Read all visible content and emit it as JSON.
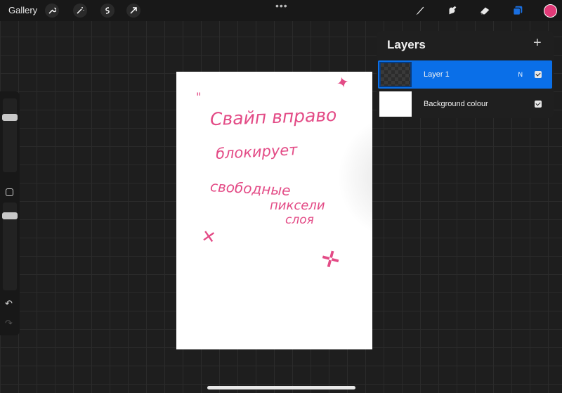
{
  "topbar": {
    "gallery_label": "Gallery",
    "more_label": "•••",
    "left_tools": [
      "wrench-icon",
      "magic-wand-icon",
      "selection-icon",
      "transform-arrow-icon"
    ],
    "right_tools": [
      "brush-icon",
      "smudge-icon",
      "eraser-icon",
      "layers-icon"
    ],
    "active_color": "#e23a78",
    "layers_accent": "#1a6fe0"
  },
  "canvas": {
    "text_lines": [
      "Свайп вправо",
      "блокирует",
      "свободные",
      "пиксели",
      "слоя"
    ],
    "quote_mark": "\"",
    "sparkle_glyphs": [
      "✦",
      "✕",
      "✛"
    ],
    "ink_color": "#e34b86"
  },
  "layers_panel": {
    "title": "Layers",
    "add_label": "+",
    "layers": [
      {
        "name": "Layer 1",
        "blend_mode": "N",
        "visible": true,
        "selected": true
      },
      {
        "name": "Background colour",
        "blend_mode": "",
        "visible": true,
        "selected": false
      }
    ]
  },
  "sidebar": {
    "undo_label": "↶",
    "redo_label": "↷"
  }
}
